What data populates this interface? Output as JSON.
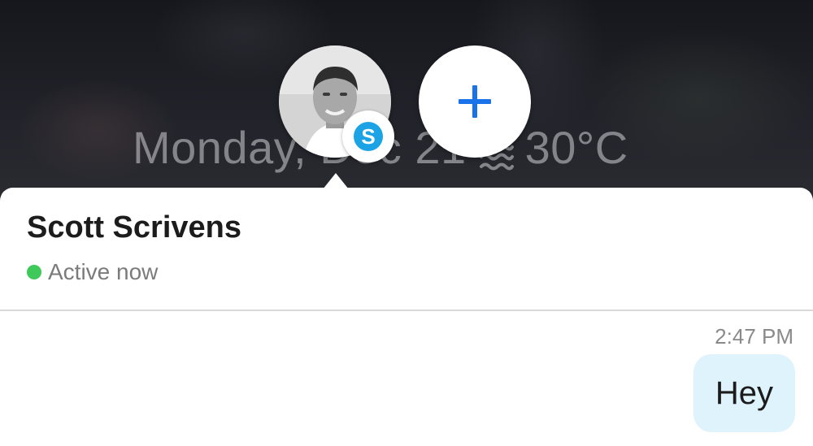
{
  "lockscreen": {
    "date": "Monday, Dec 21",
    "temperature": "30°C",
    "weather_icon": "haze-icon"
  },
  "bubbles_bar": {
    "avatar_icon": "contact-avatar",
    "badge_icon": "skype-icon",
    "badge_letter": "S",
    "add_icon": "plus-icon",
    "accent": "#1a73e8",
    "skype_color": "#1ba3e6"
  },
  "conversation": {
    "contact_name": "Scott Scrivens",
    "status": "Active now",
    "status_color": "#3ec95a",
    "messages": [
      {
        "time": "2:47 PM",
        "text": "Hey",
        "bubble_color": "#dff3fd"
      }
    ]
  }
}
